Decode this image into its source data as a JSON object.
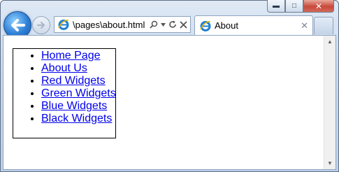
{
  "browser": {
    "address": "\\pages\\about.html",
    "tab_title": "About",
    "icons": {
      "back": "back-arrow-icon",
      "forward": "forward-arrow-icon",
      "search": "search-icon",
      "dropdown": "chevron-down-icon",
      "refresh": "refresh-icon",
      "stop": "close-icon",
      "minimize": "minimize-icon",
      "maximize": "maximize-icon",
      "close_window": "close-icon"
    },
    "colors": {
      "link": "#0000ee",
      "frame": "#bcd0e8"
    }
  },
  "page": {
    "nav_links": [
      "Home Page",
      "About Us",
      "Red Widgets",
      "Green Widgets",
      "Blue Widgets",
      "Black Widgets"
    ]
  }
}
